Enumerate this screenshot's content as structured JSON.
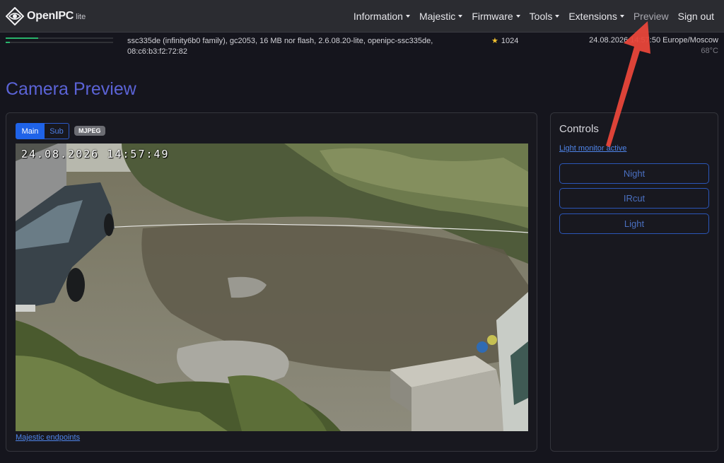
{
  "brand": {
    "name": "OpenIPC",
    "edition": "lite"
  },
  "nav": {
    "items": [
      {
        "label": "Information",
        "dropdown": true
      },
      {
        "label": "Majestic",
        "dropdown": true
      },
      {
        "label": "Firmware",
        "dropdown": true
      },
      {
        "label": "Tools",
        "dropdown": true
      },
      {
        "label": "Extensions",
        "dropdown": true
      },
      {
        "label": "Preview",
        "dropdown": false,
        "active": true
      },
      {
        "label": "Sign out",
        "dropdown": false
      }
    ]
  },
  "status": {
    "sysinfo": "ssc335de (infinity6b0 family), gc2053, 16 MB nor flash, 2.6.08.20-lite, openipc-ssc335de, 08:c6:b3:f2:72:82",
    "stars": "1024",
    "datetime": "24.08.2026 14:57:50 Europe/Moscow",
    "temperature": "68°C",
    "memory_fraction": 0.3,
    "flash_fraction": 0.04
  },
  "page": {
    "title": "Camera Preview"
  },
  "preview": {
    "stream_main": "Main",
    "stream_sub": "Sub",
    "format_badge": "MJPEG",
    "osd_timestamp": "24.08.2026 14:57:49",
    "endpoints_link": "Majestic endpoints"
  },
  "controls": {
    "title": "Controls",
    "light_monitor_link": "Light monitor active",
    "buttons": [
      "Night",
      "IRcut",
      "Light"
    ]
  },
  "colors": {
    "accent": "#5b63d6",
    "primary_button": "#1f63e8",
    "link": "#4f85ea",
    "annotation_arrow": "#e8463a"
  }
}
